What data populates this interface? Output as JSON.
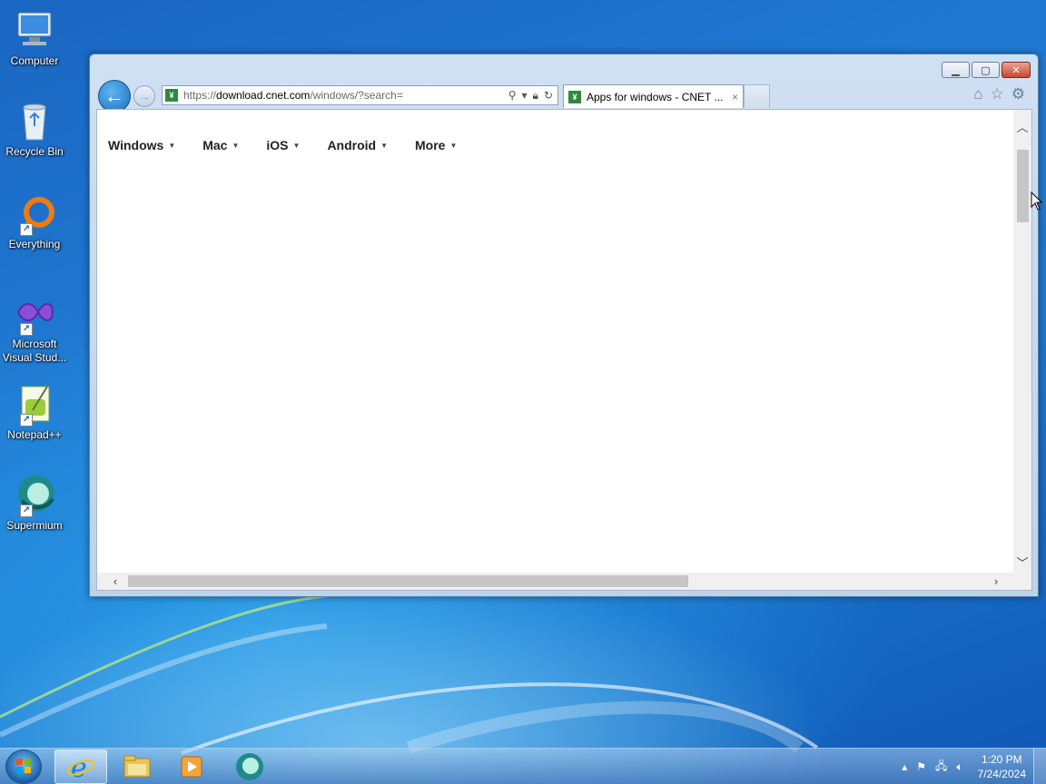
{
  "desktop": {
    "icons": [
      {
        "label": "Computer",
        "icon": "computer-icon"
      },
      {
        "label": "Recycle Bin",
        "icon": "recycle-bin-icon"
      },
      {
        "label": "Everything",
        "icon": "everything-icon"
      },
      {
        "label": "Microsoft Visual Stud...",
        "icon": "visual-studio-icon"
      },
      {
        "label": "Notepad++",
        "icon": "notepadpp-icon"
      },
      {
        "label": "Supermium",
        "icon": "supermium-icon"
      }
    ]
  },
  "browser": {
    "address": {
      "prefix": "https://",
      "host": "download.cnet.com",
      "path": "/windows/?search="
    },
    "tab": {
      "title": "Apps for windows - CNET ...",
      "close": "×"
    },
    "menu": [
      {
        "label": "Windows"
      },
      {
        "label": "Mac"
      },
      {
        "label": "iOS"
      },
      {
        "label": "Android"
      },
      {
        "label": "More"
      }
    ]
  },
  "taskbar": {
    "apps": [
      "internet-explorer-icon",
      "file-explorer-icon",
      "media-player-icon",
      "supermium-icon"
    ],
    "clock": {
      "time": "1:20 PM",
      "date": "7/24/2024"
    }
  },
  "colors": {
    "accent": "#1c6fc2",
    "favicon": "#2f8a3a"
  }
}
